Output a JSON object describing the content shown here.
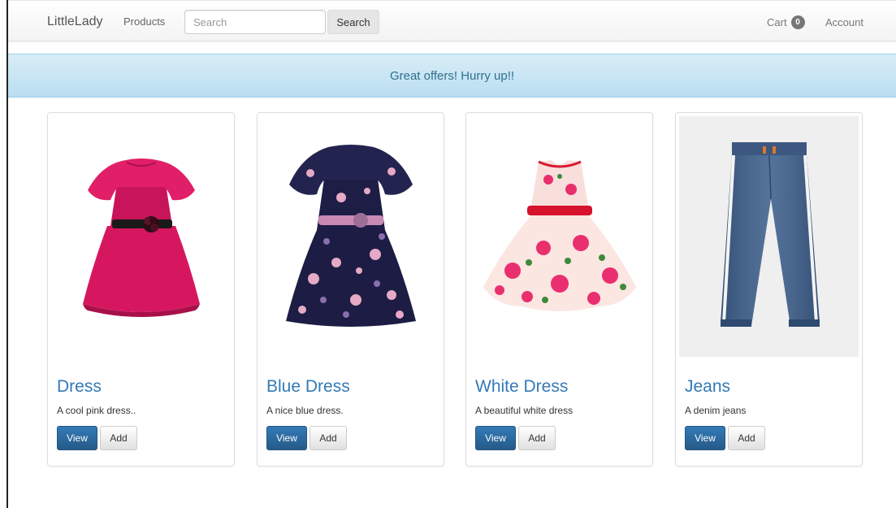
{
  "navbar": {
    "brand": "LittleLady",
    "products_link": "Products",
    "search_placeholder": "Search",
    "search_button": "Search",
    "cart_label": "Cart",
    "cart_count": "0",
    "account_link": "Account"
  },
  "banner": {
    "text": "Great offers! Hurry up!!"
  },
  "colors": {
    "primary": "#337ab7",
    "banner_bg": "#d9edf7",
    "banner_text": "#31708f"
  },
  "products": [
    {
      "title": "Dress",
      "description": "A cool pink dress..",
      "view_label": "View",
      "add_label": "Add",
      "image": "pink-dress-image"
    },
    {
      "title": "Blue Dress",
      "description": "A nice blue dress.",
      "view_label": "View",
      "add_label": "Add",
      "image": "blue-floral-dress-image"
    },
    {
      "title": "White Dress",
      "description": "A beautiful white dress",
      "view_label": "View",
      "add_label": "Add",
      "image": "white-floral-dress-image"
    },
    {
      "title": "Jeans",
      "description": "A denim jeans",
      "view_label": "View",
      "add_label": "Add",
      "image": "denim-jeans-image"
    }
  ]
}
